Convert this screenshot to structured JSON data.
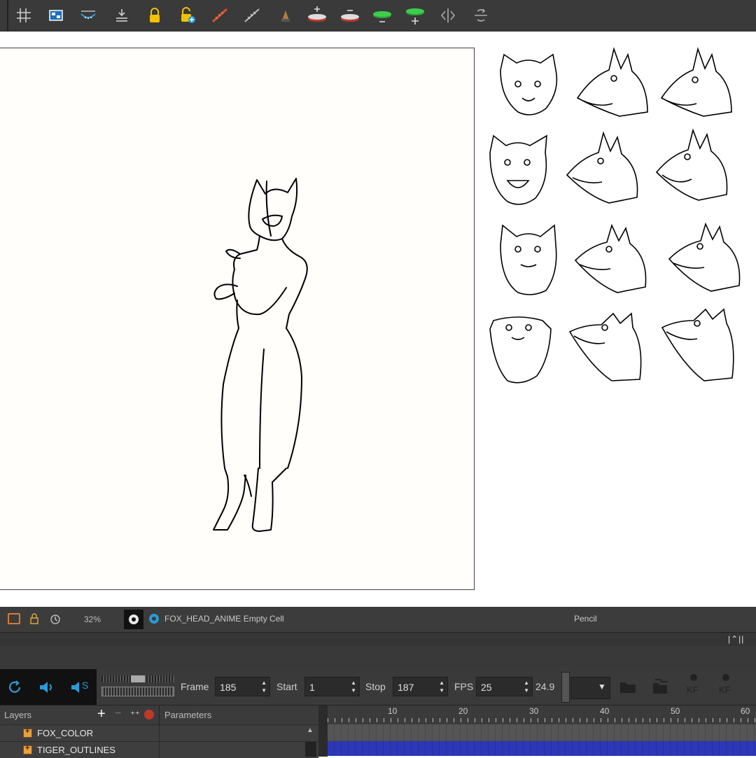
{
  "toolbar": {
    "icons": [
      "grid-icon",
      "light-table-icon",
      "onion-skin-icon",
      "import-icon",
      "lock-icon",
      "unlock-all-icon",
      "pencil-line-icon",
      "shift-line-icon",
      "brush-icon",
      "add-layer-icon",
      "remove-layer-icon",
      "add-green-layer-icon",
      "add-green-layer-alt-icon",
      "flip-horizontal-icon",
      "rotate-view-icon"
    ]
  },
  "status": {
    "zoom": "32%",
    "cell_label": "FOX_HEAD_ANIME Empty Cell",
    "tool": "Pencil"
  },
  "playback": {
    "frame_label": "Frame",
    "frame_value": "185",
    "start_label": "Start",
    "start_value": "1",
    "stop_label": "Stop",
    "stop_value": "187",
    "fps_label": "FPS",
    "fps_value": "25",
    "fps_actual": "24.9",
    "sound_label": "S",
    "kf_label_1": "KF",
    "kf_label_2": "KF"
  },
  "panels": {
    "layers_title": "Layers",
    "parameters_title": "Parameters"
  },
  "timeline": {
    "ticks": [
      "10",
      "20",
      "30",
      "40",
      "50",
      "60"
    ]
  },
  "layers": [
    {
      "name": "FOX_COLOR"
    },
    {
      "name": "TIGER_OUTLINES"
    }
  ],
  "colors": {
    "toolbar_bg": "#3a3a3a",
    "accent_blue": "#2a9bd8",
    "layer_icon": "#e8a23a",
    "timeline_blue": "#2c38b8"
  }
}
